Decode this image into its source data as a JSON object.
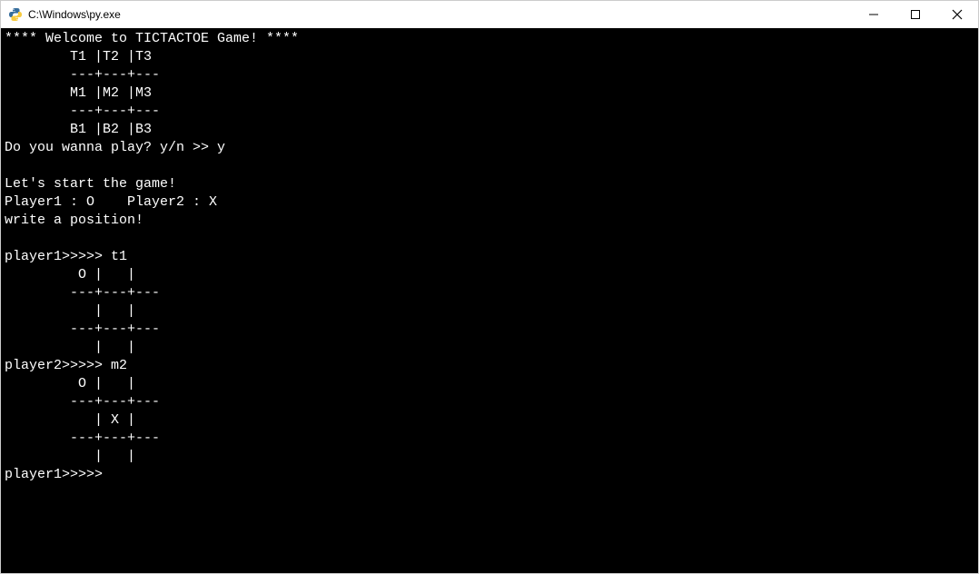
{
  "window": {
    "title": "C:\\Windows\\py.exe"
  },
  "console": {
    "lines": {
      "l0": "**** Welcome to TICTACTOE Game! ****",
      "l1": "        T1 |T2 |T3",
      "l2": "        ---+---+---",
      "l3": "        M1 |M2 |M3",
      "l4": "        ---+---+---",
      "l5": "        B1 |B2 |B3",
      "l6": "Do you wanna play? y/n >> y",
      "l7": "",
      "l8": "Let's start the game!",
      "l9": "Player1 : O    Player2 : X",
      "l10": "write a position!",
      "l11": "",
      "l12": "player1>>>>> t1",
      "l13": "         O |   |",
      "l14": "        ---+---+---",
      "l15": "           |   |",
      "l16": "        ---+---+---",
      "l17": "           |   |",
      "l18": "player2>>>>> m2",
      "l19": "         O |   |",
      "l20": "        ---+---+---",
      "l21": "           | X |",
      "l22": "        ---+---+---",
      "l23": "           |   |",
      "l24": "player1>>>>>"
    }
  }
}
